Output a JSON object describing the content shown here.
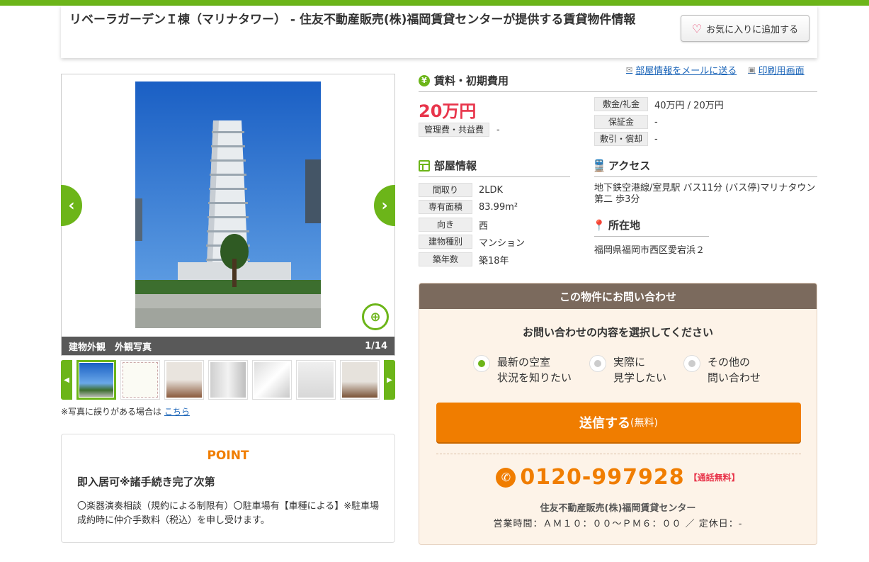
{
  "header": {
    "title": "リベーラガーデンＩ棟（マリナタワー） - 住友不動産販売(株)福岡賃貸センターが提供する賃貸物件情報",
    "fav_label": "お気に入りに追加する"
  },
  "photo": {
    "caption": "建物外観　外観写真",
    "counter": "1/14",
    "note": "※写真に誤りがある場合は",
    "note_link": "こちら"
  },
  "point": {
    "title": "POINT",
    "headline": "即入居可※諸手続き完了次第",
    "body": "〇楽器演奏相談（規約による制限有）〇駐車場有【車種による】※駐車場成約時に仲介手数料（税込）を申し受けます。"
  },
  "links": {
    "mail": "部屋情報をメールに送る",
    "print": "印刷用画面"
  },
  "rent": {
    "section_title": "賃料・初期費用",
    "price": "20万円",
    "mgmt_label": "管理費・共益費",
    "mgmt_value": "-",
    "deposit_label": "敷金/礼金",
    "deposit_value": "40万円 / 20万円",
    "guarantee_label": "保証金",
    "guarantee_value": "-",
    "shikibiki_label": "敷引・償却",
    "shikibiki_value": "-"
  },
  "room": {
    "section_title": "部屋情報",
    "rows": [
      {
        "label": "間取り",
        "value": "2LDK"
      },
      {
        "label": "専有面積",
        "value": "83.99m²"
      },
      {
        "label": "向き",
        "value": "西"
      },
      {
        "label": "建物種別",
        "value": "マンション"
      },
      {
        "label": "築年数",
        "value": "築18年"
      }
    ]
  },
  "access": {
    "section_title": "アクセス",
    "text": "地下鉄空港線/室見駅 バス11分 (バス停)マリナタウン第二 歩3分"
  },
  "address": {
    "section_title": "所在地",
    "text": "福岡県福岡市西区愛宕浜２"
  },
  "inquiry": {
    "header": "この物件にお問い合わせ",
    "question": "お問い合わせの内容を選択してください",
    "options": [
      {
        "line1": "最新の空室",
        "line2": "状況を知りたい",
        "selected": true
      },
      {
        "line1": "実際に",
        "line2": "見学したい",
        "selected": false
      },
      {
        "line1": "その他の",
        "line2": "問い合わせ",
        "selected": false
      }
    ],
    "send_label": "送信する",
    "send_sub": "(無料)",
    "phone": "0120-997928",
    "phone_free": "【通話無料】",
    "company": "住友不動産販売(株)福岡賃貸センター",
    "hours": "営業時間：ＡＭ１０：００～ＰＭ６：００ ／ 定休日：-"
  }
}
